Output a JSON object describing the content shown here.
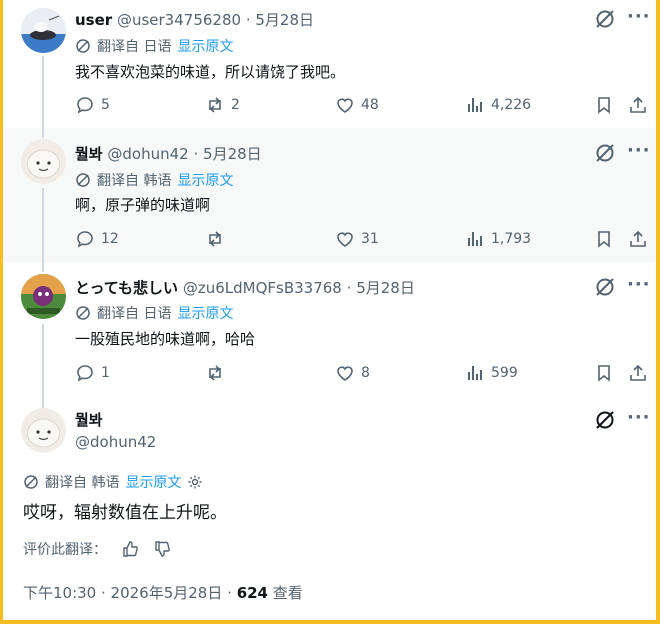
{
  "posts": [
    {
      "name": "user",
      "handle": "@user34756280",
      "dot": "·",
      "date": "5月28日",
      "translated_from": "翻译自 日语",
      "show_original": "显示原文",
      "text": "我不喜欢泡菜的味道，所以请饶了我吧。",
      "replies": "5",
      "reposts": "2",
      "likes": "48",
      "views": "4,226"
    },
    {
      "name": "뭘봐",
      "handle": "@dohun42",
      "dot": "·",
      "date": "5月28日",
      "translated_from": "翻译自 韩语",
      "show_original": "显示原文",
      "text": "啊，原子弹的味道啊",
      "replies": "12",
      "reposts": "",
      "likes": "31",
      "views": "1,793"
    },
    {
      "name": "とっても悲しい",
      "handle": "@zu6LdMQFsB33768",
      "dot": "·",
      "date": "5月28日",
      "translated_from": "翻译自 日语",
      "show_original": "显示原文",
      "text": "一股殖民地的味道啊，哈哈",
      "replies": "1",
      "reposts": "",
      "likes": "8",
      "views": "599"
    }
  ],
  "main": {
    "name": "뭘봐",
    "handle": "@dohun42",
    "translated_from": "翻译自 韩语",
    "show_original": "显示原文",
    "text": "哎呀，辐射数值在上升呢。",
    "rate_label": "评价此翻译：",
    "time": "下午10:30 · 2026年5月28日",
    "dot": "·",
    "views_count": "624",
    "views_label": "查看"
  },
  "colors": {
    "border": "#f5bd1f",
    "link": "#1d9bf0",
    "muted": "#536471",
    "text": "#0f1419"
  },
  "icons": [
    "grok-icon",
    "more-icon",
    "translate-icon",
    "reply-icon",
    "repost-icon",
    "like-icon",
    "views-icon",
    "bookmark-icon",
    "share-icon",
    "gear-icon",
    "thumbs-up-icon",
    "thumbs-down-icon"
  ]
}
